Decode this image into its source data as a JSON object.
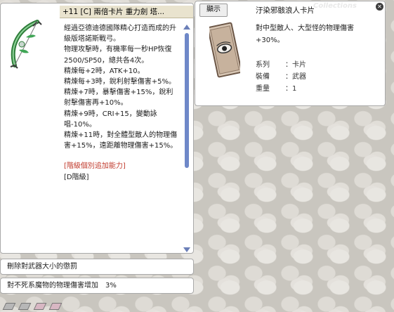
{
  "item_window": {
    "title": "+11 [C] 兩倍卡片 重力劍 塔...",
    "title_more": "...",
    "description": [
      "經過亞德迪德國隊精心打造而成的升級版塔諾斯戰弓。",
      "物理攻擊時，有機率每一秒HP恢復2500/SP50，總共各4次。",
      "精煉每+2時，ATK+10。",
      "精煉每+3時，銳利射擊傷害+5%。",
      "精煉+7時，暴擊傷害+15%，銳利射擊傷害再+10%。",
      "精煉+9時，CRI+15，變動詠唱-10%。",
      "精煉+11時，對全體型敵人的物理傷害+15%，遠距離物理傷害+15%。"
    ],
    "grade_bonus": "[階級個別追加能力]",
    "grade": "[D階級]"
  },
  "tooltip_rows": [
    "刪除對武器大小的懲罰",
    "對不死系魔物的物理傷害增加　3%"
  ],
  "card_window": {
    "show_button": "顯示",
    "title": "汙染邪骸浪人卡片",
    "watermark": "Collections",
    "description": "對中型敵人、大型怪的物理傷害+30%。",
    "properties": [
      {
        "key": "系列",
        "value": "卡片"
      },
      {
        "key": "裝備",
        "value": "武器"
      },
      {
        "key": "重量",
        "value": "1"
      }
    ],
    "separator": "："
  },
  "icons": {
    "close": "close-icon",
    "scroll_up": "scroll-up-arrow-icon",
    "scroll_down": "scroll-down-arrow-icon",
    "bow": "bow-icon",
    "card": "card-eye-icon"
  },
  "colors": {
    "title_bar": "#e9e3ce",
    "scrollbar": "#6f88c8",
    "grade_bonus_text": "#c0392b"
  }
}
